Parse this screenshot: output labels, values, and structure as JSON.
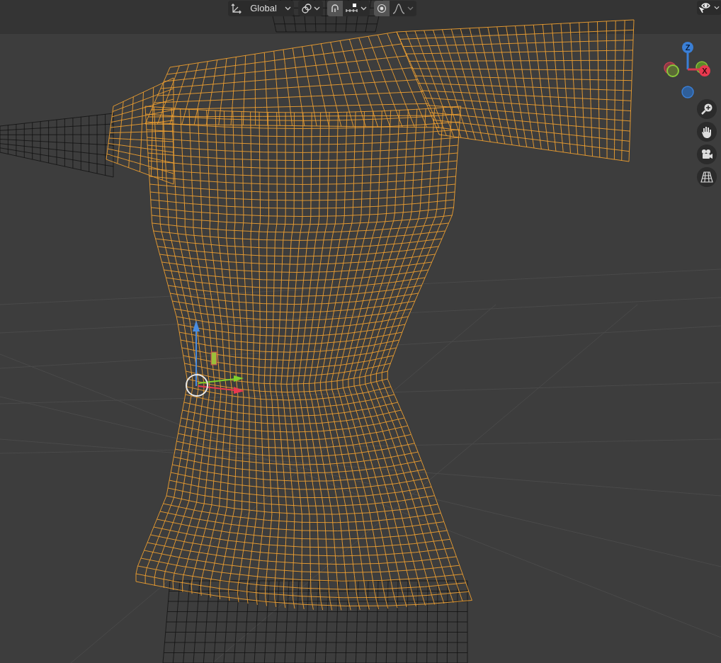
{
  "header": {
    "orientation": {
      "label": "Global"
    },
    "snap": {
      "on": true
    },
    "proportional_editing": {
      "on": true
    }
  },
  "navigation_gizmo": {
    "axes": [
      {
        "kind": "z",
        "label": "Z"
      },
      {
        "kind": "x",
        "label": "X"
      }
    ]
  }
}
